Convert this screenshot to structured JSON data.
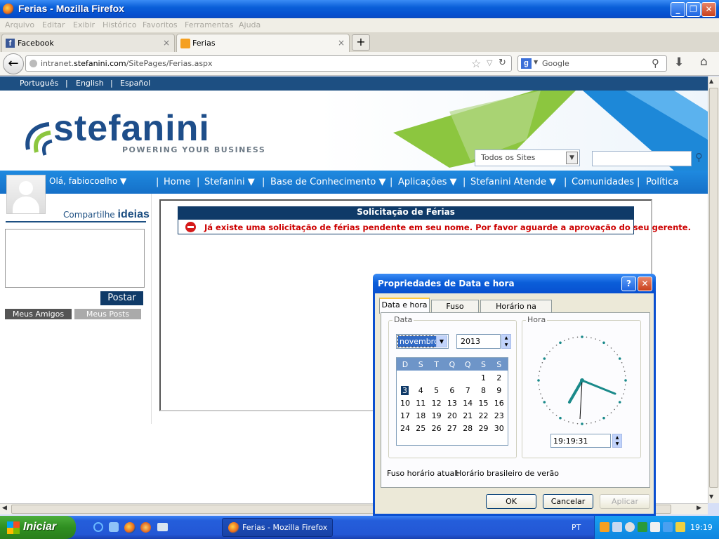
{
  "window": {
    "title": "Ferias - Mozilla Firefox"
  },
  "menu": [
    "Arquivo",
    "Editar",
    "Exibir",
    "Histórico",
    "Favoritos",
    "Ferramentas",
    "Ajuda"
  ],
  "tabs": [
    {
      "label": "Facebook",
      "close": "×"
    },
    {
      "label": "Ferias",
      "close": "×"
    }
  ],
  "new_tab": "+",
  "address": {
    "prefix": "intranet.",
    "domain": "stefanini.com",
    "path": "/SitePages/Ferias.aspx"
  },
  "search_engine": "Google",
  "languages": [
    "Português",
    "English",
    "Español"
  ],
  "logo": {
    "text": "stefanini",
    "tagline": "POWERING YOUR BUSINESS"
  },
  "site_select": "Todos os Sites",
  "nav": {
    "greeting": "Olá, fabiocoelho ▼",
    "items": [
      "Home",
      "Stefanini ▼",
      "Base de Conhecimento ▼",
      "Aplicações ▼",
      "Stefanini Atende ▼",
      "Comunidades",
      "Política"
    ]
  },
  "share": {
    "label": "Compartilhe",
    "brand": "ideias",
    "post_button": "Postar",
    "tabs": [
      "Meus Amigos",
      "Meus Posts"
    ]
  },
  "notice": {
    "title": "Solicitação de Férias",
    "message": "Já existe uma solicitação de férias pendente em seu nome. Por favor aguarde a aprovação do seu gerente."
  },
  "dialog": {
    "title": "Propriedades de Data e hora",
    "tabs": [
      "Data e hora",
      "Fuso horário",
      "Horário na Internet"
    ],
    "date_group": "Data",
    "time_group": "Hora",
    "month": "novembro",
    "year": "2013",
    "weekdays": [
      "D",
      "S",
      "T",
      "Q",
      "Q",
      "S",
      "S"
    ],
    "weeks": [
      [
        "",
        "",
        "",
        "",
        "",
        "1",
        "2"
      ],
      [
        "3",
        "4",
        "5",
        "6",
        "7",
        "8",
        "9"
      ],
      [
        "10",
        "11",
        "12",
        "13",
        "14",
        "15",
        "16"
      ],
      [
        "17",
        "18",
        "19",
        "20",
        "21",
        "22",
        "23"
      ],
      [
        "24",
        "25",
        "26",
        "27",
        "28",
        "29",
        "30"
      ]
    ],
    "selected_day": "3",
    "time": "19:19:31",
    "timezone_label": "Fuso horário atual:",
    "timezone_value": "Horário brasileiro de verão",
    "buttons": {
      "ok": "OK",
      "cancel": "Cancelar",
      "apply": "Aplicar"
    }
  },
  "taskbar": {
    "start": "Iniciar",
    "task": "Ferias - Mozilla Firefox",
    "lang": "PT",
    "clock": "19:19"
  },
  "colors": {
    "xp_blue": "#0a5fd8",
    "stefanini_blue": "#1e4e8a",
    "nav_blue": "#1778cf",
    "notice_red": "#cc0000",
    "start_green": "#3a9a2c"
  }
}
